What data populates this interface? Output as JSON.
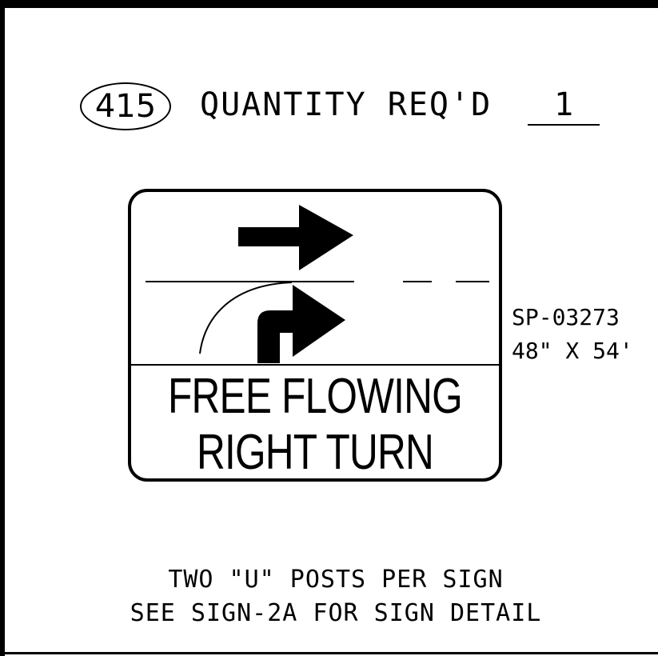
{
  "sheet": {
    "item_number": "415",
    "quantity_label": "QUANTITY REQ'D",
    "quantity_value": "1"
  },
  "sign": {
    "line1": "FREE FLOWING",
    "line2": "RIGHT TURN",
    "code": "SP-03273",
    "size": "48\" X 54'"
  },
  "notes": {
    "line1": "TWO \"U\" POSTS PER SIGN",
    "line2": "SEE SIGN-2A FOR SIGN DETAIL"
  }
}
